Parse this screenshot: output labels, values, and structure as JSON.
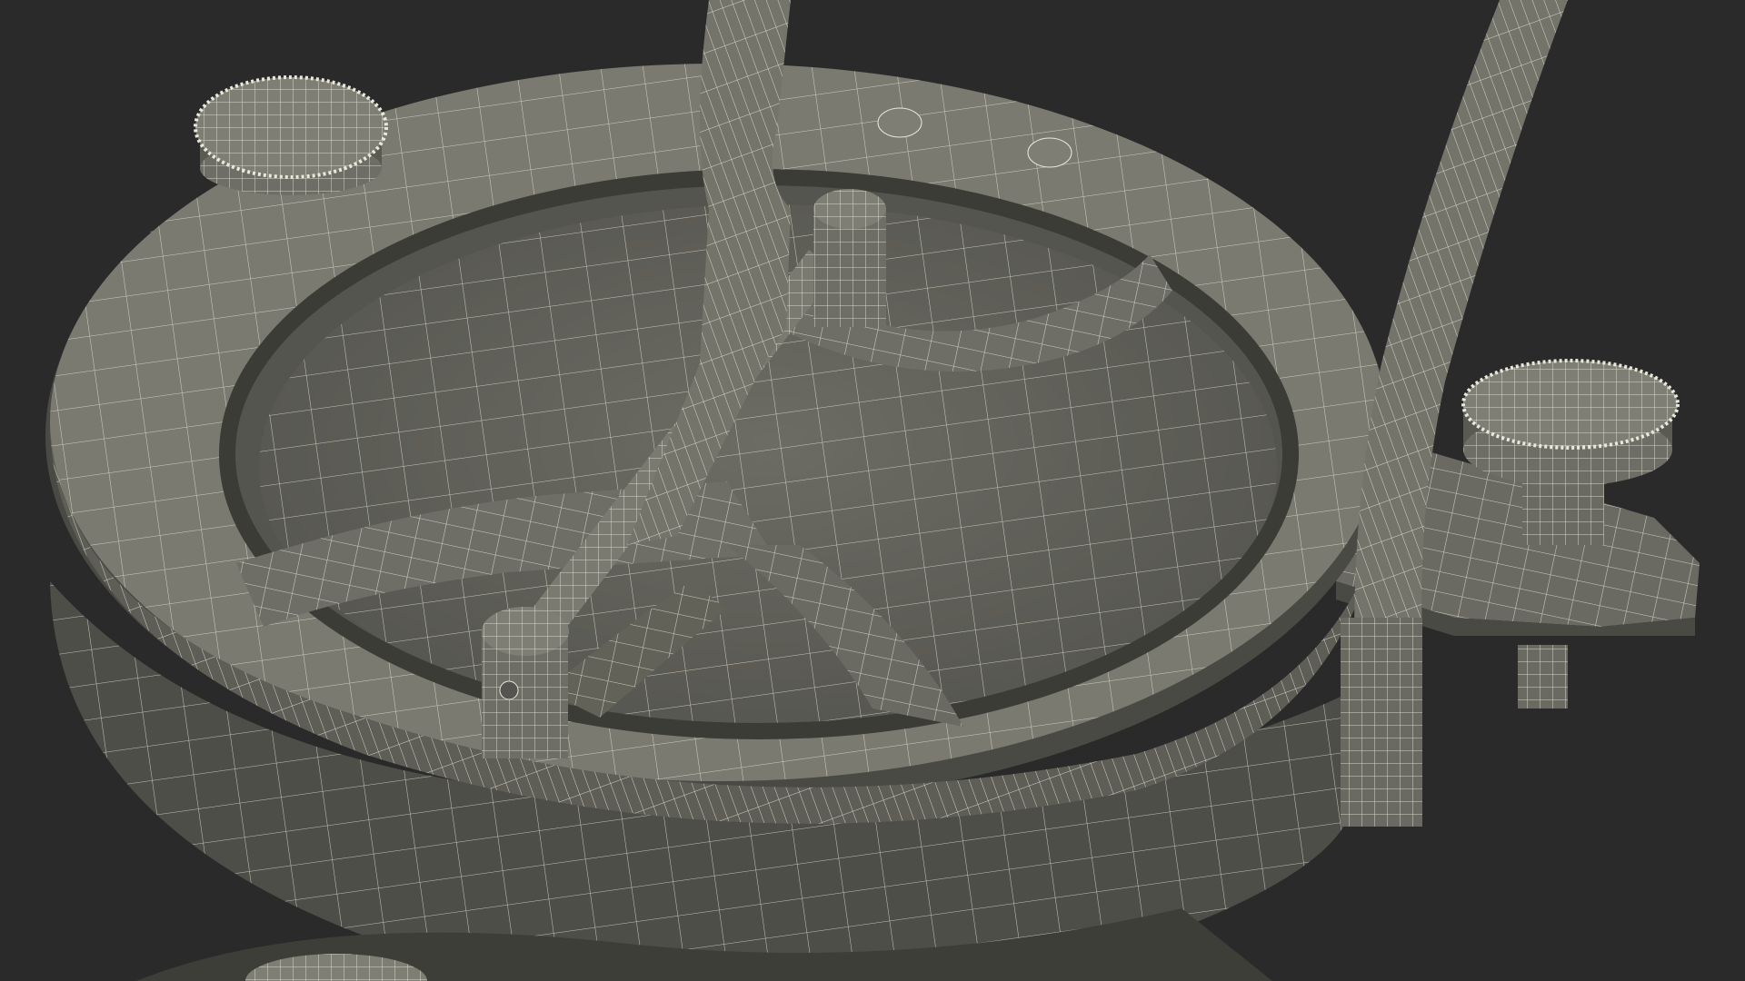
{
  "scene": {
    "subject": "wireframe-3d-model",
    "colors": {
      "background": "#2a2a2a",
      "surface_light": "#7a7a70",
      "surface_mid": "#6a6a62",
      "surface_dark": "#4e4e48",
      "surface_shadow": "#3a3a36",
      "wire": "#e8e8dc"
    }
  }
}
